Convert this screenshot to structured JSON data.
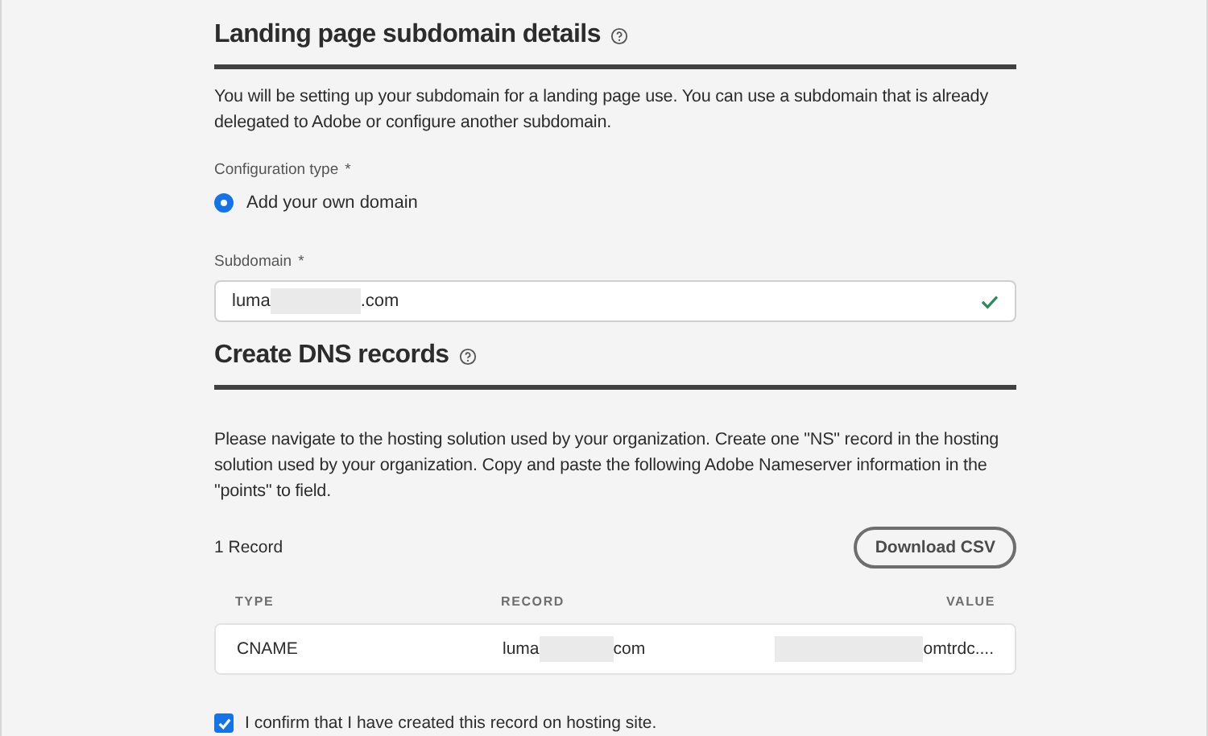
{
  "details": {
    "title": "Landing page subdomain details",
    "description": "You will be setting up your subdomain for a landing page use. You can use a subdomain that is already delegated to Adobe or configure another subdomain.",
    "config_type": {
      "label": "Configuration type",
      "required_mark": "*",
      "options": [
        {
          "label": "Add your own domain",
          "selected": true
        }
      ]
    },
    "subdomain": {
      "label": "Subdomain",
      "required_mark": "*",
      "value_start": "luma",
      "value_end": ".com",
      "valid": true
    }
  },
  "dns": {
    "title": "Create DNS records",
    "description": "Please navigate to the hosting solution used by your organization. Create one \"NS\" record in the hosting solution used by your organization. Copy and paste the following Adobe Nameserver information in the \"points\" to field.",
    "count": "1 Record",
    "download_button": "Download CSV",
    "table": {
      "columns": [
        "TYPE",
        "RECORD",
        "VALUE"
      ],
      "rows": [
        {
          "type": "CNAME",
          "record_start": "luma",
          "record_end": "com",
          "value_end": "omtrdc...."
        }
      ]
    }
  },
  "confirm": {
    "label": "I confirm that I have created this record on hosting site.",
    "checked": true
  }
}
